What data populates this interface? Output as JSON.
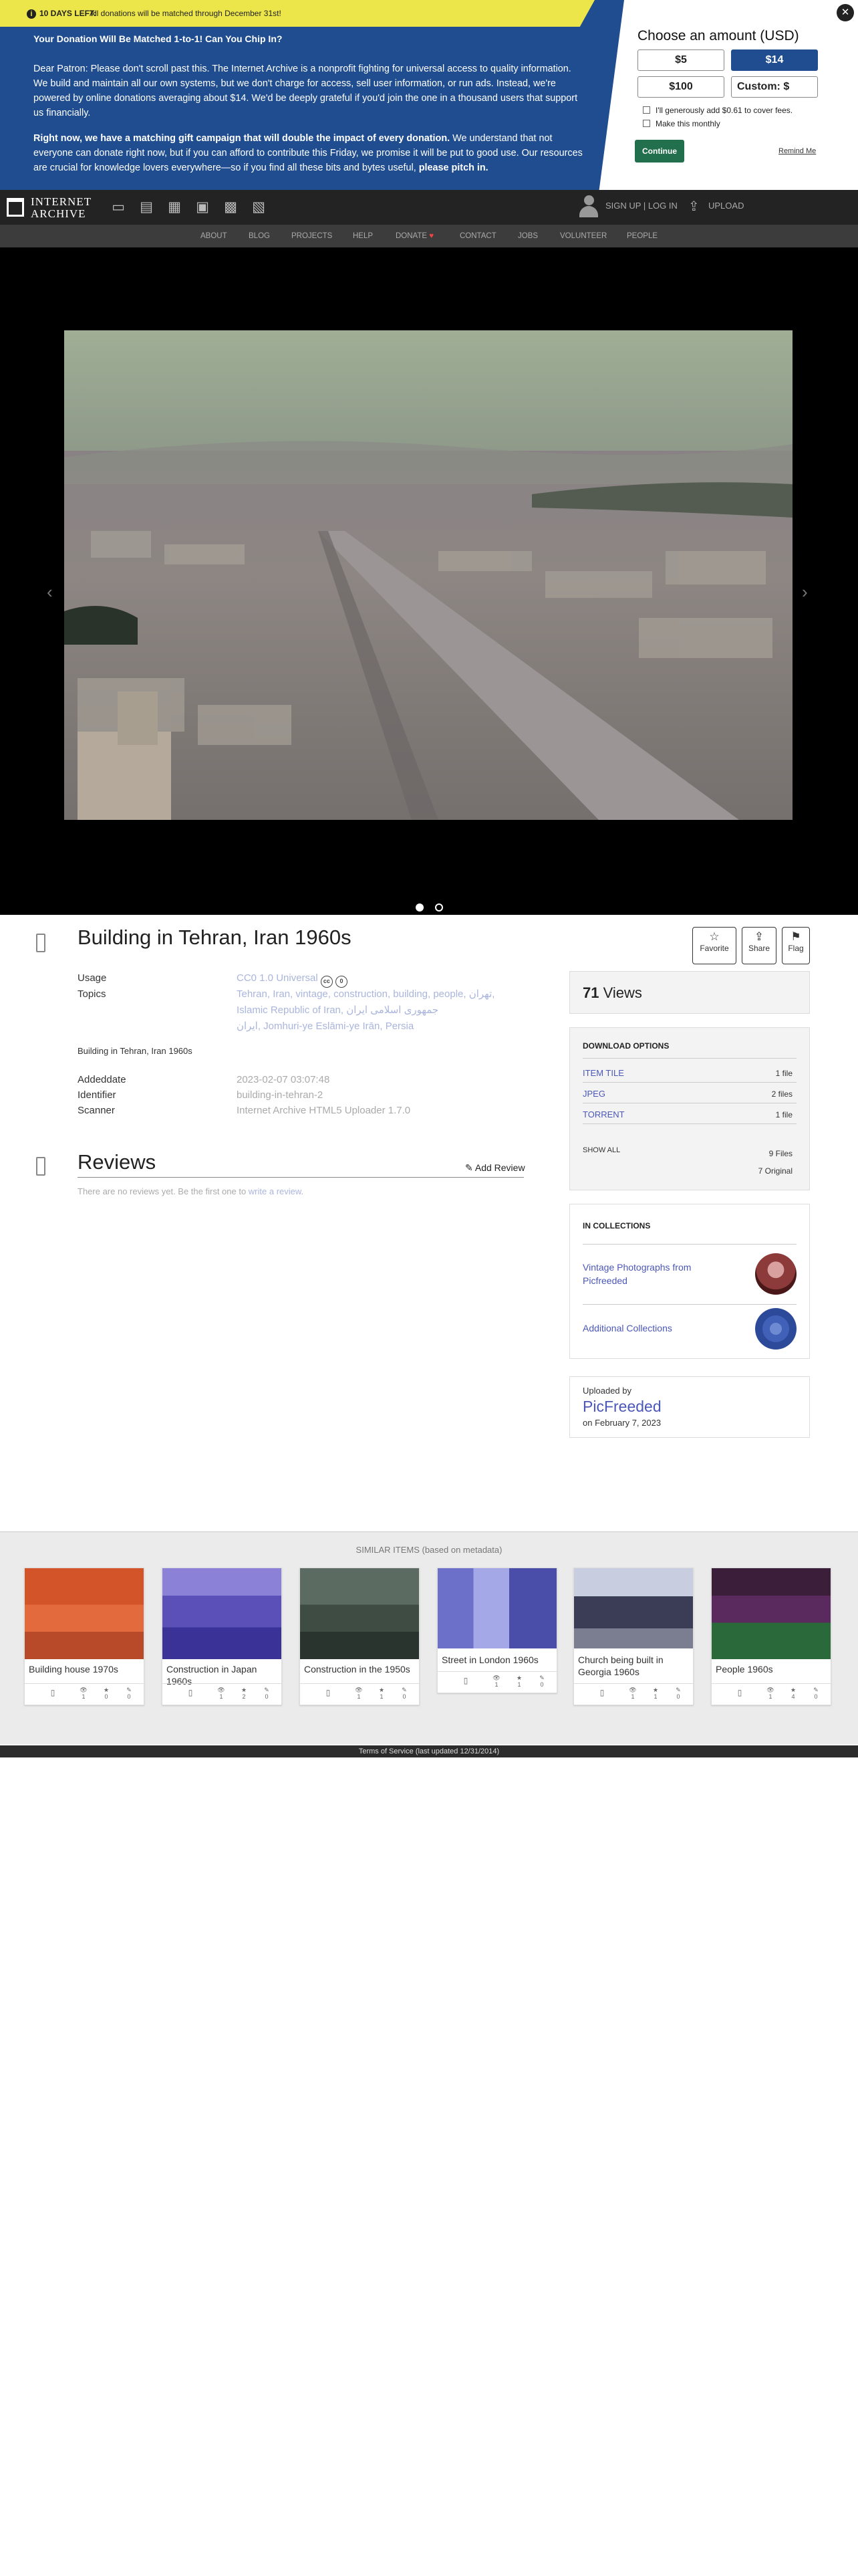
{
  "banner": {
    "days_left": "10 DAYS LEFT:",
    "matched_msg": "All donations will be matched through December 31st!",
    "headline": "Your Donation Will Be Matched 1-to-1! Can You Chip In?",
    "para1": "Dear Patron: Please don't scroll past this. The Internet Archive is a nonprofit fighting for universal access to quality information. We build and maintain all our own systems, but we don't charge for access, sell user information, or run ads. Instead, we're powered by online donations averaging about $14. We'd be deeply grateful if you'd join the one in a thousand users that support us financially.",
    "para2_bold": "Right now, we have a matching gift campaign that will double the impact of every donation.",
    "para2_rest": " We understand that not everyone can donate right now, but if you can afford to contribute this Friday, we promise it will be put to good use. Our resources are crucial for knowledge lovers everywhere—so if you find all these bits and bytes useful, ",
    "para2_end": "please pitch in.",
    "amount_title": "Choose an amount (USD)",
    "amounts": [
      "$5",
      "$14",
      "$100",
      "Custom: $"
    ],
    "cover_fees": "I'll generously add $0.61 to cover fees.",
    "monthly": "Make this monthly",
    "continue": "Continue",
    "remind": "Remind Me",
    "close": "✕"
  },
  "nav": {
    "logo_line1": "INTERNET",
    "logo_line2": "ARCHIVE",
    "signup": "SIGN UP | LOG IN",
    "upload": "UPLOAD",
    "sub_items": [
      "ABOUT",
      "BLOG",
      "PROJECTS",
      "HELP",
      "DONATE",
      "CONTACT",
      "JOBS",
      "VOLUNTEER",
      "PEOPLE"
    ]
  },
  "item": {
    "title": "Building in Tehran, Iran 1960s",
    "actions": {
      "favorite": "Favorite",
      "share": "Share",
      "flag": "Flag"
    },
    "usage_label": "Usage",
    "usage_value": "CC0 1.0 Universal",
    "topics_label": "Topics",
    "topics_line1": "Tehran, Iran, vintage, construction, building, people, تهران,",
    "topics_line2": "Islamic Republic of Iran, جمهوری اسلامی ایران",
    "topics_line3": "ایران, Jomhuri-ye Eslāmi-ye Irān, Persia",
    "description": "Building in Tehran, Iran 1960s",
    "addeddate_label": "Addeddate",
    "addeddate": "2023-02-07 03:07:48",
    "identifier_label": "Identifier",
    "identifier": "building-in-tehran-2",
    "scanner_label": "Scanner",
    "scanner": "Internet Archive HTML5 Uploader 1.7.0"
  },
  "reviews": {
    "title": "Reviews",
    "add": "Add Review",
    "none_text": "There are no reviews yet. Be the first one to ",
    "none_link": "write a review",
    "none_end": "."
  },
  "sidebar": {
    "views_count": "71",
    "views_label": " Views",
    "download_title": "DOWNLOAD OPTIONS",
    "downloads": [
      {
        "label": "ITEM TILE",
        "count": "1 file"
      },
      {
        "label": "JPEG",
        "count": "2 files"
      },
      {
        "label": "TORRENT",
        "count": "1 file"
      }
    ],
    "show_all": "SHOW ALL",
    "total_files": "9 Files",
    "original": "7 Original",
    "collections_title": "IN COLLECTIONS",
    "collections": [
      "Vintage Photographs from Picfreeded",
      "Additional Collections"
    ],
    "uploaded_by": "Uploaded by",
    "uploader": "PicFreeded",
    "upload_date": "on February 7, 2023"
  },
  "similar": {
    "title": "SIMILAR ITEMS (based on metadata)",
    "items": [
      {
        "title": "Building house 1970s",
        "views": "1",
        "favs": "0",
        "reviews": "0"
      },
      {
        "title": "Construction in Japan 1960s",
        "views": "1",
        "favs": "2",
        "reviews": "0"
      },
      {
        "title": "Construction in the 1950s",
        "views": "1",
        "favs": "1",
        "reviews": "0"
      },
      {
        "title": "Street in London 1960s",
        "views": "1",
        "favs": "1",
        "reviews": "0"
      },
      {
        "title": "Church being built in Georgia 1960s",
        "views": "1",
        "favs": "1",
        "reviews": "0"
      },
      {
        "title": "People 1960s",
        "views": "1",
        "favs": "4",
        "reviews": "0"
      }
    ]
  },
  "footer": "Terms of Service (last updated 12/31/2014)",
  "colors": {
    "banner_blue": "#1f4d8f",
    "banner_yellow": "#ede64a",
    "continue_green": "#226f4d",
    "link_blue": "#4b57b8"
  }
}
